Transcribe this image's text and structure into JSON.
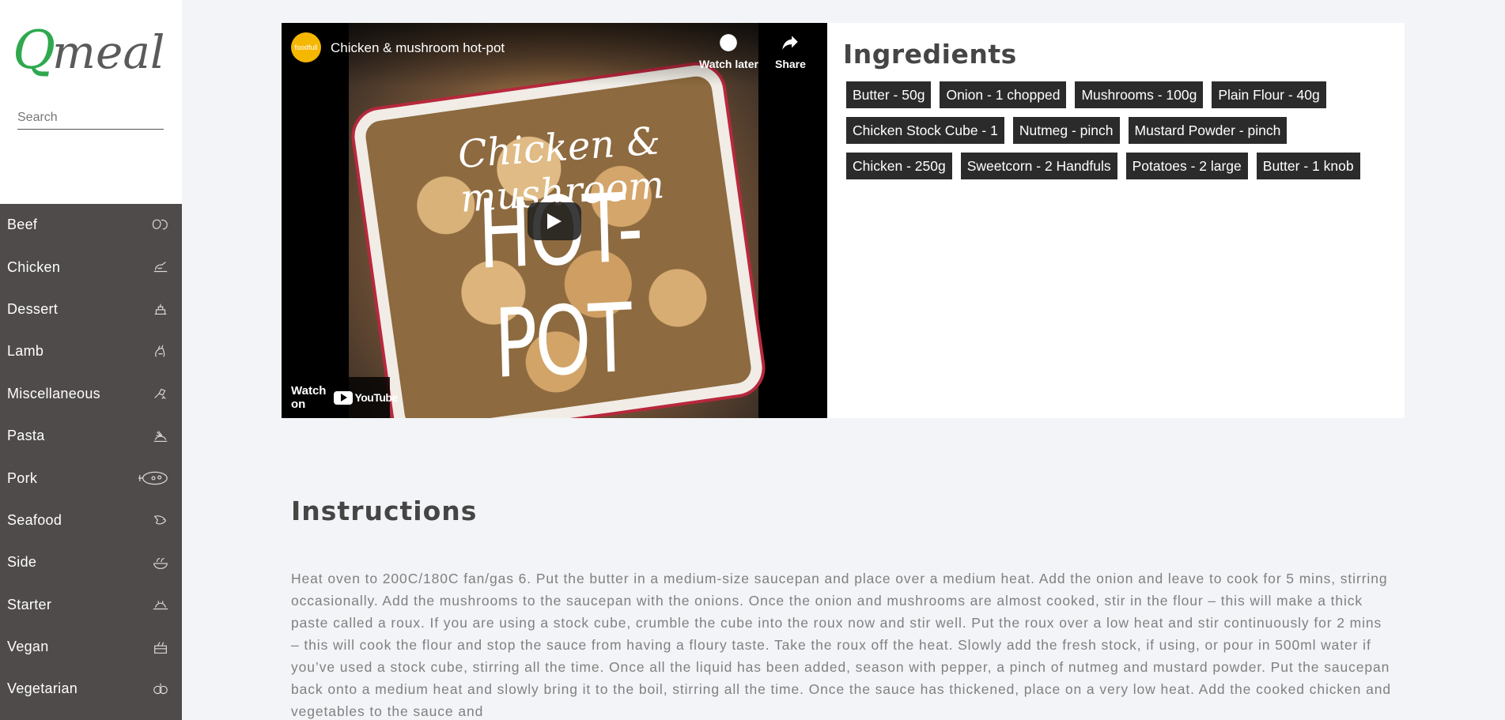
{
  "brand": {
    "logo_text": "Qmeal",
    "logo_color": "#2fa84f"
  },
  "search": {
    "placeholder": "Search"
  },
  "categories": [
    {
      "label": "Beef",
      "icon": "beef-icon"
    },
    {
      "label": "Chicken",
      "icon": "chicken-icon"
    },
    {
      "label": "Dessert",
      "icon": "dessert-icon"
    },
    {
      "label": "Lamb",
      "icon": "lamb-icon"
    },
    {
      "label": "Miscellaneous",
      "icon": "miscellaneous-icon"
    },
    {
      "label": "Pasta",
      "icon": "pasta-icon"
    },
    {
      "label": "Pork",
      "icon": "pork-icon"
    },
    {
      "label": "Seafood",
      "icon": "seafood-icon"
    },
    {
      "label": "Side",
      "icon": "side-icon"
    },
    {
      "label": "Starter",
      "icon": "starter-icon"
    },
    {
      "label": "Vegan",
      "icon": "vegan-icon"
    },
    {
      "label": "Vegetarian",
      "icon": "vegetarian-icon"
    }
  ],
  "video": {
    "channel_badge": "foodfull",
    "title": "Chicken & mushroom hot-pot",
    "watch_later": "Watch later",
    "share": "Share",
    "overlay_line1": "Chicken & mushroom",
    "overlay_line2": "HOT-POT",
    "watch_on": "Watch on",
    "youtube": "YouTube"
  },
  "ingredients": {
    "title": "Ingredients",
    "items": [
      "Butter - 50g",
      "Onion - 1 chopped",
      "Mushrooms - 100g",
      "Plain Flour - 40g",
      "Chicken Stock Cube - 1",
      "Nutmeg - pinch",
      "Mustard Powder - pinch",
      "Chicken - 250g",
      "Sweetcorn - 2 Handfuls",
      "Potatoes - 2 large",
      "Butter - 1 knob"
    ]
  },
  "instructions": {
    "title": "Instructions",
    "text": "Heat oven to 200C/180C fan/gas 6. Put the butter in a medium-size saucepan and place over a medium heat. Add the onion and leave to cook for 5 mins, stirring occasionally. Add the mushrooms to the saucepan with the onions. Once the onion and mushrooms are almost cooked, stir in the flour – this will make a thick paste called a roux. If you are using a stock cube, crumble the cube into the roux now and stir well. Put the roux over a low heat and stir continuously for 2 mins – this will cook the flour and stop the sauce from having a floury taste. Take the roux off the heat. Slowly add the fresh stock, if using, or pour in 500ml water if you’ve used a stock cube, stirring all the time. Once all the liquid has been added, season with pepper, a pinch of nutmeg and mustard powder. Put the saucepan back onto a medium heat and slowly bring it to the boil, stirring all the time. Once the sauce has thickened, place on a very low heat. Add the cooked chicken and vegetables to the sauce and"
  }
}
